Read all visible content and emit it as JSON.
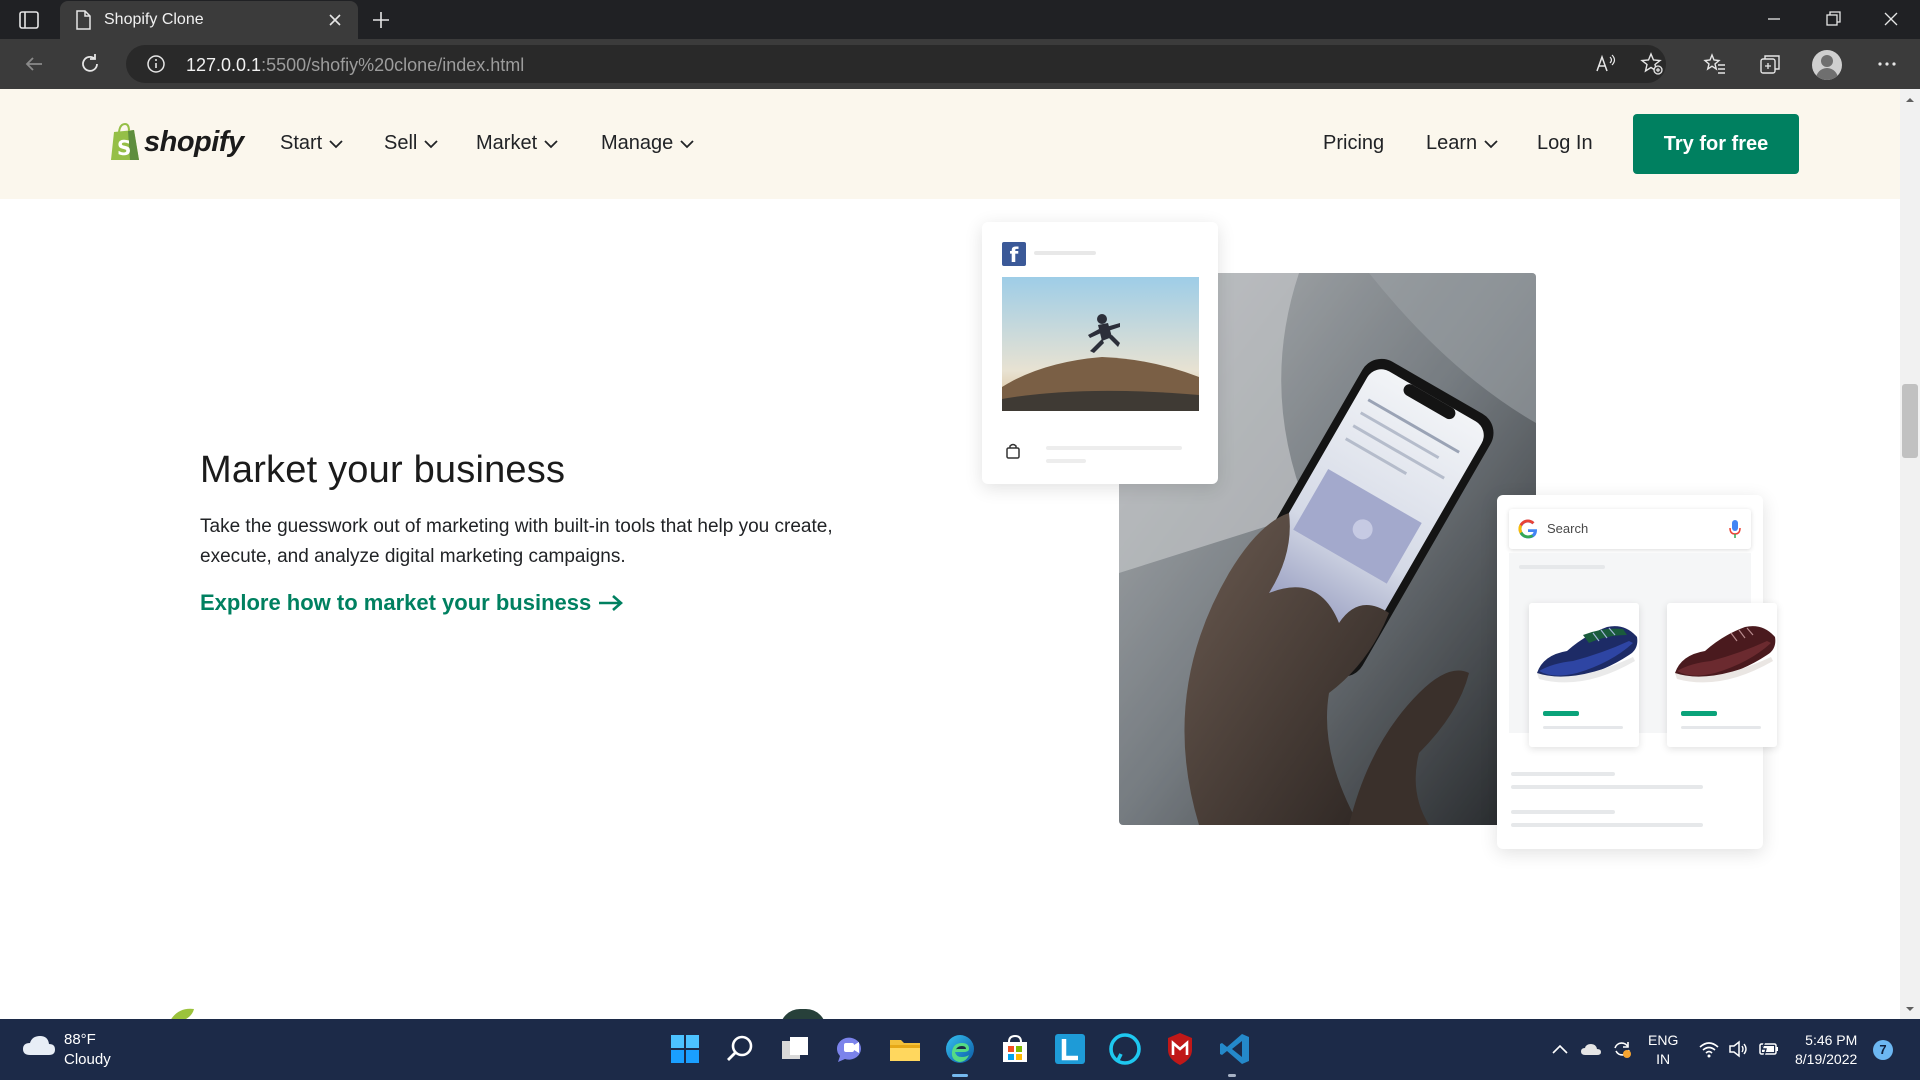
{
  "browser": {
    "tab_title": "Shopify Clone",
    "url_host": "127.0.0.1",
    "url_rest": ":5500/shofiy%20clone/index.html"
  },
  "header": {
    "logo_text": "shopify",
    "nav": [
      {
        "label": "Start"
      },
      {
        "label": "Sell"
      },
      {
        "label": "Market"
      },
      {
        "label": "Manage"
      }
    ],
    "pricing": "Pricing",
    "learn": "Learn",
    "login": "Log In",
    "cta": "Try for free"
  },
  "section": {
    "heading": "Market your business",
    "description": "Take the guesswork out of marketing with built-in tools that help you create, execute, and analyze digital marketing campaigns.",
    "link": "Explore how to market your business"
  },
  "illustration": {
    "google_search_placeholder": "Search"
  },
  "taskbar": {
    "weather_temp": "88°F",
    "weather_desc": "Cloudy",
    "lang_1": "ENG",
    "lang_2": "IN",
    "time": "5:46 PM",
    "date": "8/19/2022",
    "notification_count": "7"
  },
  "colors": {
    "brand_green": "#008060",
    "header_bg": "#fbf7ed",
    "taskbar_bg": "#1c2a48"
  }
}
